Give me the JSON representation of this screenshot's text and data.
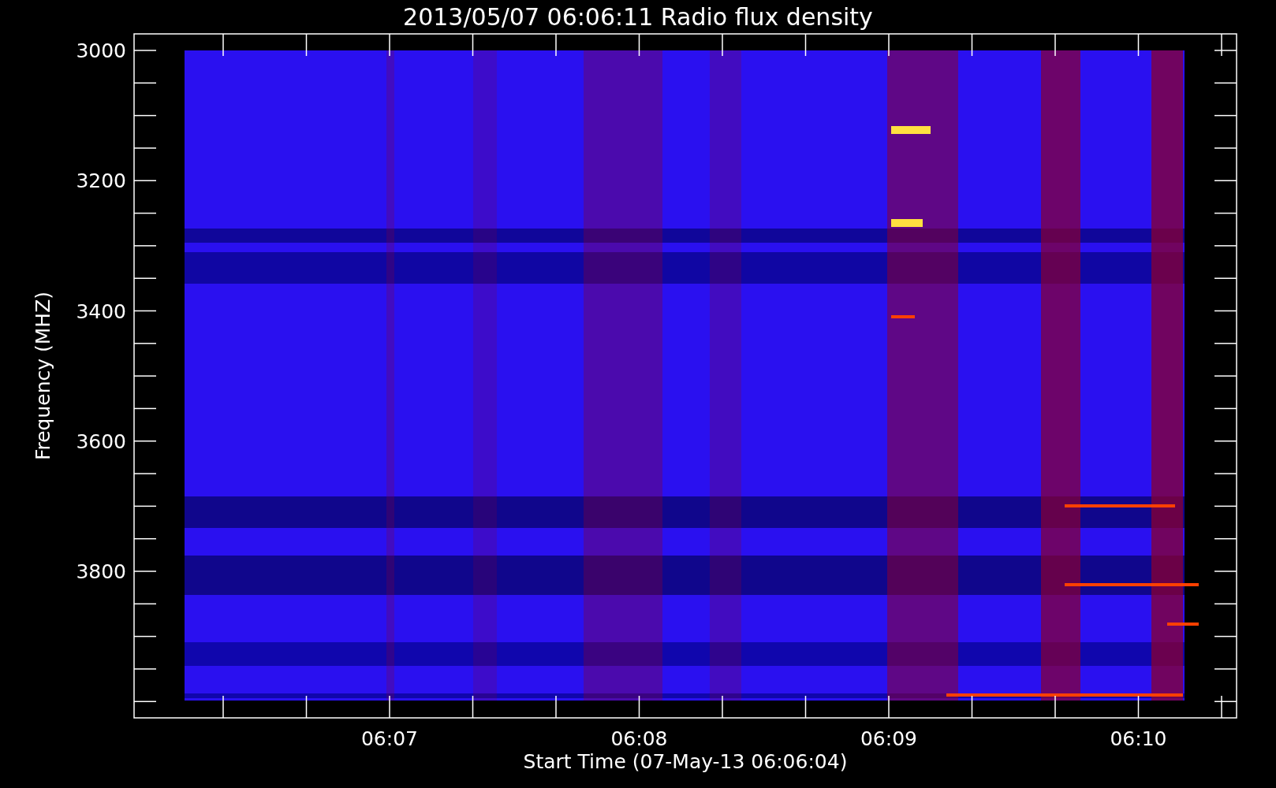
{
  "title": "2013/05/07 06:06:11 Radio flux density",
  "y_axis": {
    "label": "Frequency (MHZ)",
    "tick_labels": [
      "3000",
      "3200",
      "3400",
      "3600",
      "3800"
    ]
  },
  "x_axis": {
    "label": "Start Time (07-May-13 06:06:04)",
    "tick_labels": [
      "06:07",
      "06:08",
      "06:09",
      "06:10"
    ]
  }
}
